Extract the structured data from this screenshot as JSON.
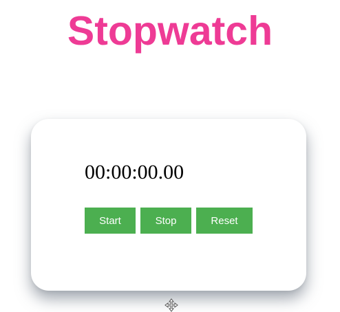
{
  "title": "Stopwatch",
  "colors": {
    "title": "#ee3b95",
    "button_bg": "#4caf50",
    "button_text": "#ffffff",
    "card_bg": "#ffffff"
  },
  "stopwatch": {
    "time": "00:00:00.00",
    "start_label": "Start",
    "stop_label": "Stop",
    "reset_label": "Reset"
  },
  "icons": {
    "cursor": "move-cursor-icon"
  }
}
